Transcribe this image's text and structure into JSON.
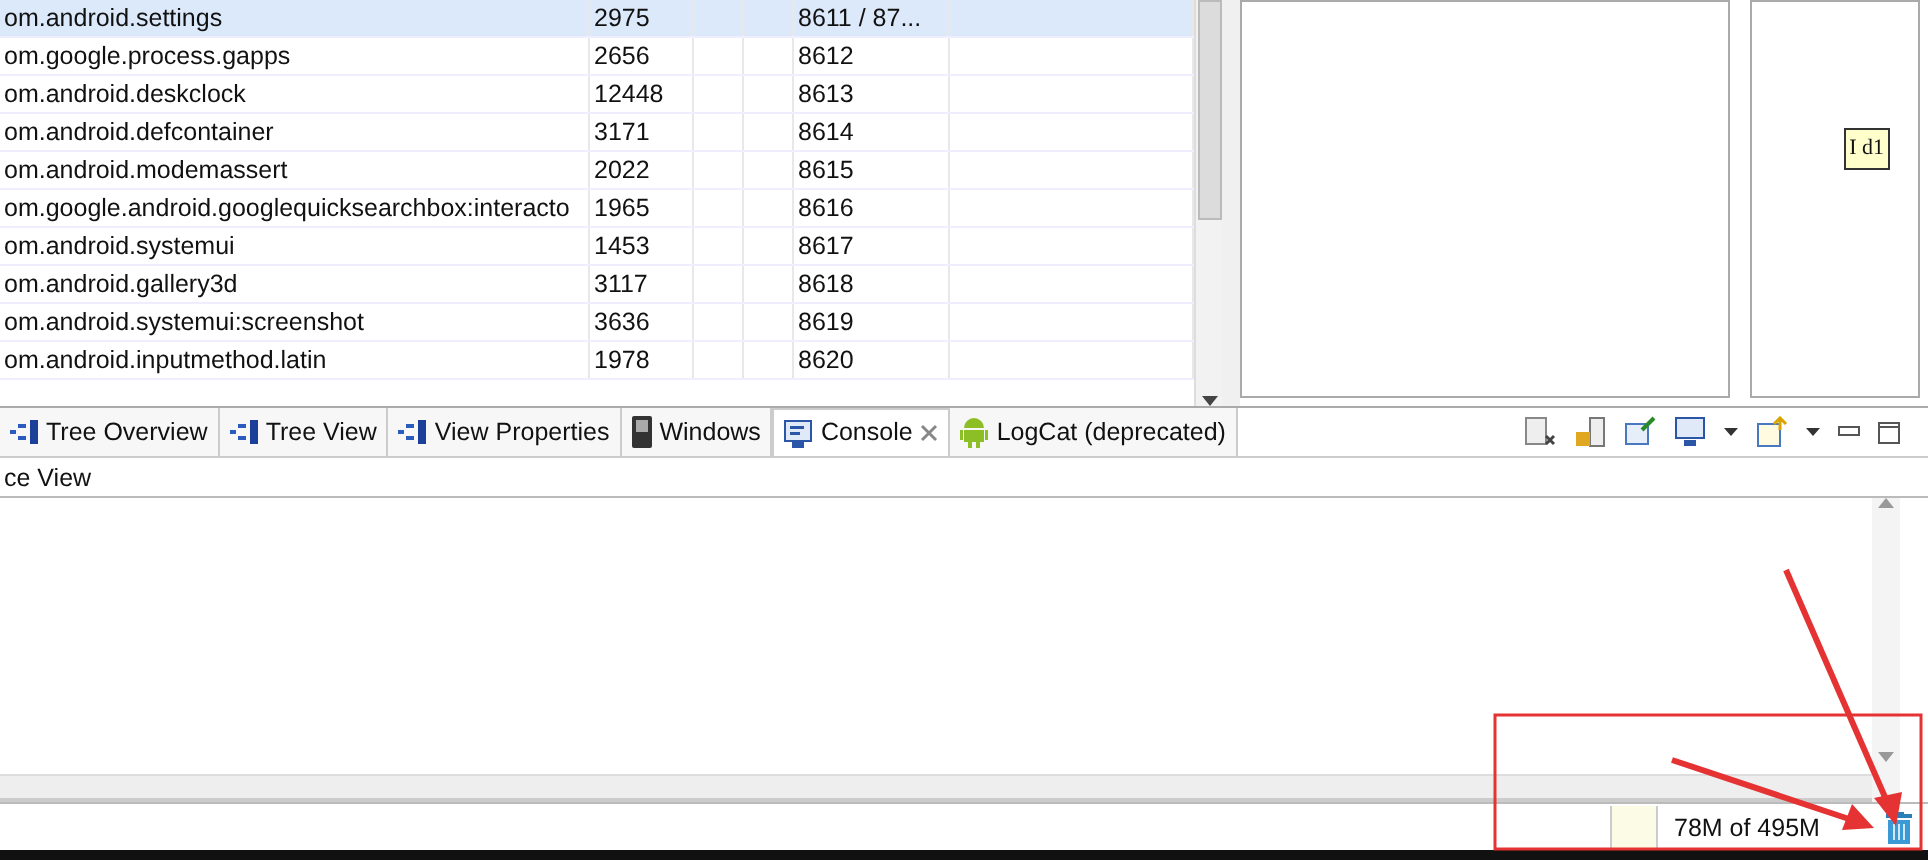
{
  "process_table": {
    "rows": [
      {
        "column_1": "om.android.settings",
        "column_2": "2975",
        "column_3": "8611 / 87...",
        "selected": true
      },
      {
        "column_1": "om.google.process.gapps",
        "column_2": "2656",
        "column_3": "8612",
        "selected": false
      },
      {
        "column_1": "om.android.deskclock",
        "column_2": "12448",
        "column_3": "8613",
        "selected": false
      },
      {
        "column_1": "om.android.defcontainer",
        "column_2": "3171",
        "column_3": "8614",
        "selected": false
      },
      {
        "column_1": "om.android.modemassert",
        "column_2": "2022",
        "column_3": "8615",
        "selected": false
      },
      {
        "column_1": "om.google.android.googlequicksearchbox:interacto",
        "column_2": "1965",
        "column_3": "8616",
        "selected": false
      },
      {
        "column_1": "om.android.systemui",
        "column_2": "1453",
        "column_3": "8617",
        "selected": false
      },
      {
        "column_1": "om.android.gallery3d",
        "column_2": "3117",
        "column_3": "8618",
        "selected": false
      },
      {
        "column_1": "om.android.systemui:screenshot",
        "column_2": "3636",
        "column_3": "8619",
        "selected": false
      },
      {
        "column_1": "om.android.inputmethod.latin",
        "column_2": "1978",
        "column_3": "8620",
        "selected": false
      }
    ]
  },
  "hierarchy_node": {
    "label": "I d1"
  },
  "tabs": [
    {
      "label": "Tree Overview",
      "kind": "tree",
      "selected": false,
      "closable": false
    },
    {
      "label": "Tree View",
      "kind": "tree",
      "selected": false,
      "closable": false
    },
    {
      "label": "View Properties",
      "kind": "tree",
      "selected": false,
      "closable": false
    },
    {
      "label": "Windows",
      "kind": "phone",
      "selected": false,
      "closable": false
    },
    {
      "label": "Console",
      "kind": "console",
      "selected": true,
      "closable": true
    },
    {
      "label": "LogCat (deprecated)",
      "kind": "android",
      "selected": false,
      "closable": false
    }
  ],
  "console": {
    "title": "ce View"
  },
  "status_bar": {
    "heap": "78M of 495M"
  }
}
